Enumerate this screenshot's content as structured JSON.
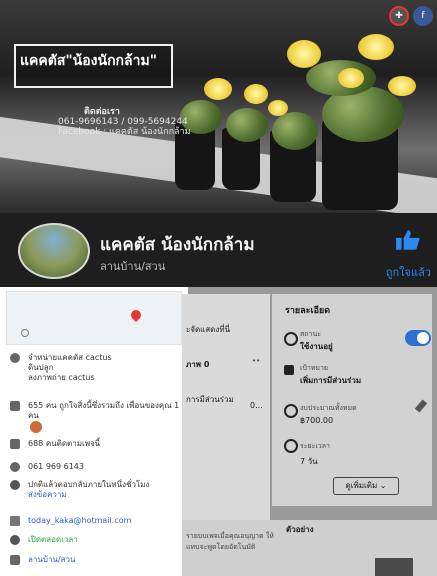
{
  "cover": {
    "logo_text": "แคคตัส\"น้องนักกล้าม\"",
    "contact_title": "ติดต่อเรา",
    "contact_phone": "061-9696143 / 099-5694244",
    "contact_facebook": "Facebook : แคคตัส น้องนักกล้าม"
  },
  "profile": {
    "name": "แคคตัส น้องนักกล้าม",
    "category": "ลานบ้าน/สวน",
    "like_label": "ถูกใจแล้ว",
    "like_color": "#2d89ef"
  },
  "info": {
    "about_line1": "จำหน่ายแคคตัส cactus",
    "about_line2": "ดินปลูก",
    "about_line3": "ลงภาพถ่าย cactus",
    "likes_text": "655 คน ถูกใจสิ่งนี้ซึ่งรวมถึง เพื่อนของคุณ 1 คน",
    "followers_text": "688 คนติดตามเพจนี้",
    "phone": "061 969 6143",
    "reply_text": "ปกติแล้วตอบกลับภายในหนึ่งชั่วโมง",
    "send_message": "ส่งข้อความ",
    "email": "today_kaka@hotmail.com",
    "open_status": "เปิดตลอดเวลา",
    "category_link": "ลานบ้าน/สวน"
  },
  "panel": {
    "card1_line1": "ะจัดแสดงที่นี่",
    "card1_line2": "ภาพ 0",
    "card1_line3": "การมีส่วนร่วม",
    "card1_line4": "0...",
    "card1_bottom1": "รายบบเพจเมื่อคุณอนุญาต ให้",
    "card1_bottom2": "แทบจะพูดโดยอัตโนมัติ",
    "details_title": "รายละเอียด",
    "status_label": "สถานะ",
    "status_value": "ใช้งานอยู่",
    "goal_label": "เป้าหมาย",
    "goal_value": "เพิ่มการมีส่วนร่วม",
    "budget_label": "งบประมาณทั้งหมด",
    "budget_value": "฿700.00",
    "duration_label": "ระยะเวลา",
    "duration_value": "7 วัน",
    "see_more": "ดูเพิ่มเติม ⌄",
    "example_label": "ตัวอย่าง"
  }
}
